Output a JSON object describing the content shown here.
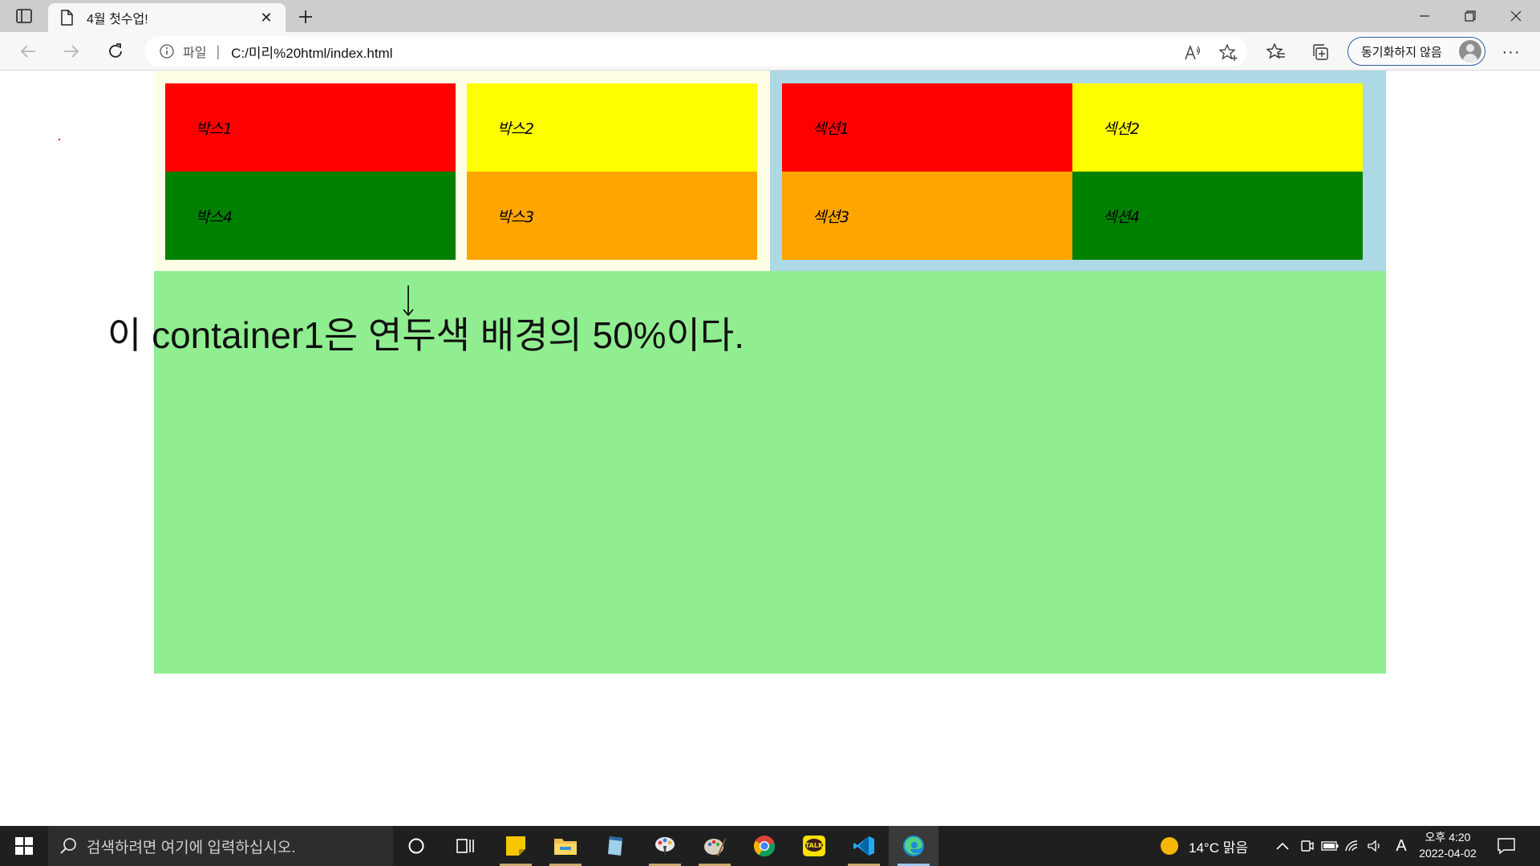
{
  "browser": {
    "tab_title": "4월 첫수업!",
    "tab_close": "✕",
    "address": {
      "scheme": "파일",
      "separator": "|",
      "url": "C:/미리%20html/index.html"
    },
    "sync_label": "동기화하지 않음",
    "more": "···"
  },
  "page": {
    "container1": {
      "boxes": [
        "박스1",
        "박스2",
        "박스4",
        "박스3"
      ]
    },
    "container2": {
      "sections": [
        "섹션1",
        "섹션2",
        "섹션3",
        "섹션4"
      ]
    },
    "caption": "이 container1은 연두색 배경의 50%이다.",
    "colors": {
      "red": "#ff0000",
      "yellow": "#ffff00",
      "green": "#008000",
      "orange": "#ffa500",
      "lightyellow": "#ffffe5",
      "lightblue": "#add8e6",
      "lightgreen": "#90ee90"
    }
  },
  "taskbar": {
    "search_placeholder": "검색하려면 여기에 입력하십시오.",
    "weather": "14°C 맑음",
    "ime": "A",
    "time": "오후 4:20",
    "date": "2022-04-02",
    "apps": [
      "sticky-notes",
      "file-explorer",
      "notepad",
      "paint-3d",
      "paint",
      "chrome",
      "kakaotalk",
      "vscode",
      "edge"
    ]
  }
}
